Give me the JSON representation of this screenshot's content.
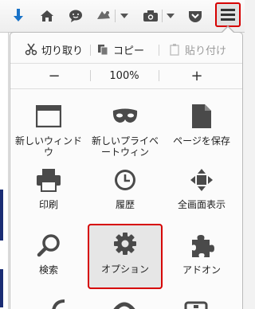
{
  "toolbar": {
    "icons": [
      "download-icon",
      "home-icon",
      "chat-icon",
      "extension-icon",
      "screenshot-icon",
      "pocket-icon",
      "hamburger-menu-icon"
    ]
  },
  "panel": {
    "edit": {
      "cut": "切り取り",
      "copy": "コピー",
      "paste": "貼り付け"
    },
    "zoom": {
      "minus": "−",
      "value": "100%",
      "plus": "+"
    },
    "tiles": [
      {
        "label": "新しいウィンドウ",
        "icon": "new-window-icon"
      },
      {
        "label": "新しいプライベートウィン",
        "icon": "private-mask-icon"
      },
      {
        "label": "ページを保存",
        "icon": "save-page-icon"
      },
      {
        "label": "印刷",
        "icon": "print-icon"
      },
      {
        "label": "履歴",
        "icon": "history-clock-icon"
      },
      {
        "label": "全画面表示",
        "icon": "fullscreen-icon"
      },
      {
        "label": "検索",
        "icon": "search-icon"
      },
      {
        "label": "オプション",
        "icon": "options-gear-icon"
      },
      {
        "label": "アドオン",
        "icon": "addons-puzzle-icon"
      }
    ]
  },
  "colors": {
    "highlight": "#d60000",
    "accent_blue": "#1a73c8",
    "icon_gray": "#4a4a4a"
  }
}
